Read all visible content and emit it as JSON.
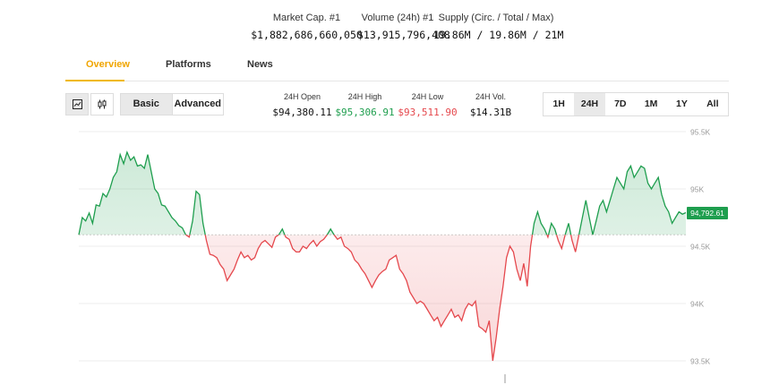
{
  "stats": {
    "market_cap_label": "Market Cap. #1",
    "market_cap_value": "$1,882,686,660,050",
    "volume_label": "Volume (24h) #1",
    "volume_value": "$13,915,796,408",
    "supply_label": "Supply (Circ. / Total / Max)",
    "supply_value": "19.86M / 19.86M / 21M"
  },
  "tabs": [
    {
      "label": "Overview"
    },
    {
      "label": "Platforms"
    },
    {
      "label": "News"
    }
  ],
  "toolbar": {
    "view_basic": "Basic",
    "view_advanced": "Advanced",
    "open_label": "24H Open",
    "open_value": "$94,380.11",
    "high_label": "24H High",
    "high_value": "$95,306.91",
    "low_label": "24H Low",
    "low_value": "$93,511.90",
    "vol_label": "24H Vol.",
    "vol_value": "$14.31B",
    "ranges": [
      "1H",
      "24H",
      "7D",
      "1M",
      "1Y",
      "All"
    ]
  },
  "colors": {
    "accent": "#f0b90b",
    "up": "#1e9e4e",
    "down": "#e5484d"
  },
  "chart_data": {
    "type": "area",
    "baseline": 94600,
    "current_price_label": "94,792.61",
    "y_ticks": [
      "95.5K",
      "95K",
      "94.5K",
      "94K",
      "93.5K"
    ],
    "y_tick_values": [
      95500,
      95000,
      94500,
      94000,
      93500
    ],
    "ylim": [
      93450,
      95500
    ],
    "series": [
      {
        "values": [
          94600,
          94750,
          94720,
          94790,
          94700,
          94860,
          94850,
          94960,
          94930,
          95000,
          95100,
          95150,
          95300,
          95220,
          95320,
          95250,
          95280,
          95200,
          95210,
          95180,
          95300,
          95150,
          95000,
          94960,
          94860,
          94850,
          94800,
          94750,
          94720,
          94680,
          94660,
          94600,
          94580,
          94720,
          94980,
          94950,
          94700,
          94550,
          94430,
          94420,
          94400,
          94340,
          94300,
          94200,
          94250,
          94300,
          94380,
          94450,
          94400,
          94420,
          94380,
          94400,
          94480,
          94530,
          94550,
          94520,
          94490,
          94580,
          94600,
          94650,
          94580,
          94560,
          94480,
          94450,
          94450,
          94500,
          94480,
          94520,
          94550,
          94500,
          94540,
          94560,
          94600,
          94650,
          94600,
          94560,
          94580,
          94500,
          94480,
          94450,
          94380,
          94350,
          94300,
          94260,
          94200,
          94140,
          94200,
          94250,
          94280,
          94300,
          94380,
          94400,
          94420,
          94300,
          94260,
          94200,
          94100,
          94050,
          94000,
          94020,
          94000,
          93950,
          93900,
          93850,
          93880,
          93800,
          93850,
          93900,
          93950,
          93880,
          93900,
          93850,
          93950,
          94000,
          93980,
          94020,
          93800,
          93780,
          93750,
          93850,
          93500,
          93700,
          93950,
          94150,
          94400,
          94500,
          94450,
          94300,
          94200,
          94350,
          94150,
          94500,
          94700,
          94800,
          94700,
          94650,
          94580,
          94700,
          94650,
          94550,
          94480,
          94600,
          94700,
          94550,
          94450,
          94600,
          94750,
          94900,
          94750,
          94600,
          94720,
          94850,
          94900,
          94800,
          94900,
          95000,
          95100,
          95050,
          95000,
          95150,
          95200,
          95100,
          95150,
          95200,
          95180,
          95050,
          95000,
          95050,
          95100,
          94950,
          94850,
          94800,
          94700,
          94750,
          94800,
          94780,
          94792.61
        ]
      }
    ]
  }
}
